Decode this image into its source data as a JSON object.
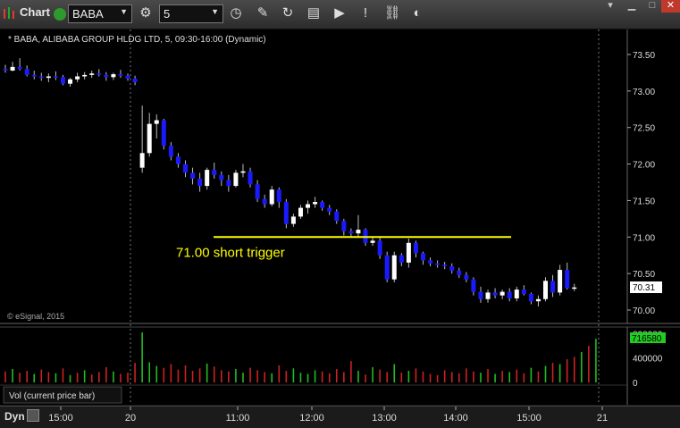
{
  "toolbar": {
    "app_title": "Chart",
    "symbol_value": "BABA",
    "interval_value": "5",
    "icons": [
      "app-menu-icon",
      "symbol-settings-icon",
      "history-icon",
      "draw-pencil-icon",
      "refresh-icon",
      "studies-icon",
      "play-icon",
      "alert-icon",
      "link-icon",
      "color-icon",
      "window-menu-icon",
      "minimize-icon",
      "close-icon"
    ]
  },
  "chart_data": [
    {
      "type": "candlestick",
      "title": "* BABA, ALIBABA GROUP HLDG LTD, 5, 09:30-16:00 (Dynamic)",
      "watermark": "© eSignal, 2015",
      "yticks": [
        "73.50",
        "73.00",
        "72.50",
        "72.00",
        "71.50",
        "71.00",
        "70.50",
        "70.00"
      ],
      "ylim": [
        69.9,
        73.75
      ],
      "last_price": "70.31",
      "x_labels": [
        "15:00",
        "20",
        "11:00",
        "12:00",
        "13:00",
        "14:00",
        "15:00",
        "21"
      ],
      "annotation": {
        "text": "71.00 short trigger",
        "level": 71.0,
        "color": "#ffff00"
      },
      "candles": [
        [
          73.3,
          73.36,
          73.25,
          73.28
        ],
        [
          73.28,
          73.4,
          73.27,
          73.33
        ],
        [
          73.33,
          73.45,
          73.28,
          73.3
        ],
        [
          73.3,
          73.35,
          73.2,
          73.22
        ],
        [
          73.22,
          73.28,
          73.16,
          73.2
        ],
        [
          73.2,
          73.25,
          73.14,
          73.18
        ],
        [
          73.18,
          73.24,
          73.12,
          73.2
        ],
        [
          73.2,
          73.27,
          73.15,
          73.19
        ],
        [
          73.19,
          73.22,
          73.08,
          73.1
        ],
        [
          73.1,
          73.18,
          73.06,
          73.16
        ],
        [
          73.16,
          73.25,
          73.12,
          73.2
        ],
        [
          73.2,
          73.26,
          73.16,
          73.22
        ],
        [
          73.22,
          73.28,
          73.18,
          73.24
        ],
        [
          73.24,
          73.3,
          73.2,
          73.22
        ],
        [
          73.22,
          73.26,
          73.14,
          73.19
        ],
        [
          73.19,
          73.25,
          73.15,
          73.23
        ],
        [
          73.23,
          73.29,
          73.18,
          73.21
        ],
        [
          73.21,
          73.24,
          73.14,
          73.17
        ],
        [
          73.17,
          73.21,
          73.08,
          73.12
        ],
        [
          71.95,
          72.8,
          71.88,
          72.15
        ],
        [
          72.15,
          72.7,
          72.1,
          72.55
        ],
        [
          72.55,
          72.68,
          72.35,
          72.6
        ],
        [
          72.6,
          72.62,
          72.2,
          72.25
        ],
        [
          72.25,
          72.3,
          72.05,
          72.1
        ],
        [
          72.1,
          72.15,
          71.95,
          72.0
        ],
        [
          72.0,
          72.05,
          71.82,
          71.88
        ],
        [
          71.88,
          71.95,
          71.72,
          71.8
        ],
        [
          71.8,
          71.88,
          71.62,
          71.7
        ],
        [
          71.7,
          71.95,
          71.65,
          71.92
        ],
        [
          71.92,
          72.02,
          71.8,
          71.85
        ],
        [
          71.85,
          71.9,
          71.7,
          71.78
        ],
        [
          71.78,
          71.85,
          71.62,
          71.7
        ],
        [
          71.7,
          71.92,
          71.68,
          71.88
        ],
        [
          71.88,
          72.0,
          71.82,
          71.9
        ],
        [
          71.9,
          71.95,
          71.68,
          71.72
        ],
        [
          71.72,
          71.78,
          71.48,
          71.52
        ],
        [
          71.52,
          71.58,
          71.4,
          71.45
        ],
        [
          71.45,
          71.7,
          71.42,
          71.65
        ],
        [
          71.65,
          71.68,
          71.4,
          71.48
        ],
        [
          71.48,
          71.52,
          71.12,
          71.18
        ],
        [
          71.18,
          71.32,
          71.14,
          71.28
        ],
        [
          71.28,
          71.44,
          71.25,
          71.4
        ],
        [
          71.4,
          71.5,
          71.32,
          71.45
        ],
        [
          71.45,
          71.55,
          71.4,
          71.48
        ],
        [
          71.48,
          71.5,
          71.36,
          71.4
        ],
        [
          71.4,
          71.44,
          71.3,
          71.35
        ],
        [
          71.35,
          71.38,
          71.18,
          71.22
        ],
        [
          71.22,
          71.25,
          71.02,
          71.08
        ],
        [
          71.08,
          71.12,
          71.0,
          71.05
        ],
        [
          71.05,
          71.3,
          71.0,
          71.1
        ],
        [
          71.1,
          71.12,
          70.88,
          70.92
        ],
        [
          70.92,
          71.0,
          70.88,
          70.95
        ],
        [
          70.95,
          71.0,
          70.7,
          70.75
        ],
        [
          70.75,
          70.8,
          70.38,
          70.42
        ],
        [
          70.42,
          70.8,
          70.38,
          70.75
        ],
        [
          70.75,
          70.78,
          70.6,
          70.65
        ],
        [
          70.65,
          70.98,
          70.58,
          70.92
        ],
        [
          70.92,
          70.95,
          70.72,
          70.78
        ],
        [
          70.78,
          70.8,
          70.62,
          70.68
        ],
        [
          70.68,
          70.72,
          70.6,
          70.64
        ],
        [
          70.64,
          70.68,
          70.58,
          70.62
        ],
        [
          70.62,
          70.66,
          70.56,
          70.6
        ],
        [
          70.6,
          70.64,
          70.5,
          70.54
        ],
        [
          70.54,
          70.58,
          70.44,
          70.48
        ],
        [
          70.48,
          70.52,
          70.38,
          70.42
        ],
        [
          70.42,
          70.45,
          70.2,
          70.25
        ],
        [
          70.25,
          70.32,
          70.1,
          70.15
        ],
        [
          70.15,
          70.28,
          70.1,
          70.24
        ],
        [
          70.24,
          70.3,
          70.16,
          70.2
        ],
        [
          70.2,
          70.28,
          70.15,
          70.25
        ],
        [
          70.25,
          70.3,
          70.12,
          70.16
        ],
        [
          70.16,
          70.32,
          70.12,
          70.28
        ],
        [
          70.28,
          70.34,
          70.2,
          70.22
        ],
        [
          70.22,
          70.24,
          70.08,
          70.12
        ],
        [
          70.12,
          70.2,
          70.05,
          70.15
        ],
        [
          70.15,
          70.45,
          70.12,
          70.4
        ],
        [
          70.4,
          70.48,
          70.18,
          70.24
        ],
        [
          70.24,
          70.62,
          70.2,
          70.55
        ],
        [
          70.55,
          70.65,
          70.28,
          70.3
        ],
        [
          70.3,
          70.36,
          70.26,
          70.31
        ]
      ]
    },
    {
      "type": "bar",
      "title": "Vol (current price bar)",
      "yticks": [
        "800000",
        "400000",
        "0"
      ],
      "ylim": [
        0,
        850000
      ],
      "last_value": "716580",
      "values": [
        180000,
        220000,
        160000,
        190000,
        140000,
        210000,
        170000,
        150000,
        230000,
        120000,
        160000,
        200000,
        130000,
        170000,
        250000,
        180000,
        140000,
        160000,
        320000,
        820000,
        330000,
        270000,
        240000,
        300000,
        210000,
        280000,
        190000,
        230000,
        310000,
        260000,
        200000,
        180000,
        220000,
        160000,
        240000,
        200000,
        170000,
        150000,
        280000,
        190000,
        230000,
        160000,
        140000,
        200000,
        180000,
        150000,
        220000,
        170000,
        350000,
        190000,
        130000,
        250000,
        210000,
        170000,
        300000,
        160000,
        190000,
        230000,
        180000,
        140000,
        120000,
        200000,
        170000,
        150000,
        230000,
        180000,
        160000,
        220000,
        140000,
        190000,
        170000,
        210000,
        150000,
        240000,
        180000,
        270000,
        320000,
        300000,
        380000,
        420000,
        500000,
        600000,
        716580
      ],
      "colors": [
        "#cc2222",
        "#22bb22",
        "#cc2222",
        "#cc2222",
        "#22bb22",
        "#cc2222",
        "#cc2222",
        "#22bb22",
        "#cc2222",
        "#22bb22",
        "#cc2222",
        "#22bb22",
        "#cc2222",
        "#cc2222",
        "#cc2222",
        "#22bb22",
        "#cc2222",
        "#cc2222",
        "#cc2222",
        "#22bb22",
        "#22bb22",
        "#22bb22",
        "#cc2222",
        "#cc2222",
        "#cc2222",
        "#cc2222",
        "#cc2222",
        "#cc2222",
        "#22bb22",
        "#cc2222",
        "#cc2222",
        "#cc2222",
        "#22bb22",
        "#22bb22",
        "#cc2222",
        "#cc2222",
        "#cc2222",
        "#22bb22",
        "#cc2222",
        "#cc2222",
        "#22bb22",
        "#22bb22",
        "#22bb22",
        "#22bb22",
        "#cc2222",
        "#cc2222",
        "#cc2222",
        "#cc2222",
        "#cc2222",
        "#22bb22",
        "#cc2222",
        "#22bb22",
        "#cc2222",
        "#cc2222",
        "#22bb22",
        "#cc2222",
        "#22bb22",
        "#cc2222",
        "#cc2222",
        "#cc2222",
        "#cc2222",
        "#cc2222",
        "#cc2222",
        "#cc2222",
        "#cc2222",
        "#cc2222",
        "#22bb22",
        "#cc2222",
        "#22bb22",
        "#cc2222",
        "#22bb22",
        "#cc2222",
        "#cc2222",
        "#22bb22",
        "#cc2222",
        "#22bb22",
        "#cc2222",
        "#22bb22",
        "#cc2222",
        "#cc2222",
        "#22bb22",
        "#cc2222",
        "#22bb22"
      ]
    }
  ],
  "bottom_bar": {
    "dyn_label": "Dyn"
  },
  "colors": {
    "up_candle": "#ffffff",
    "down_candle": "#1a1aff",
    "price_label_bg": "#ffffff",
    "volume_label_bg": "#22cc22"
  }
}
